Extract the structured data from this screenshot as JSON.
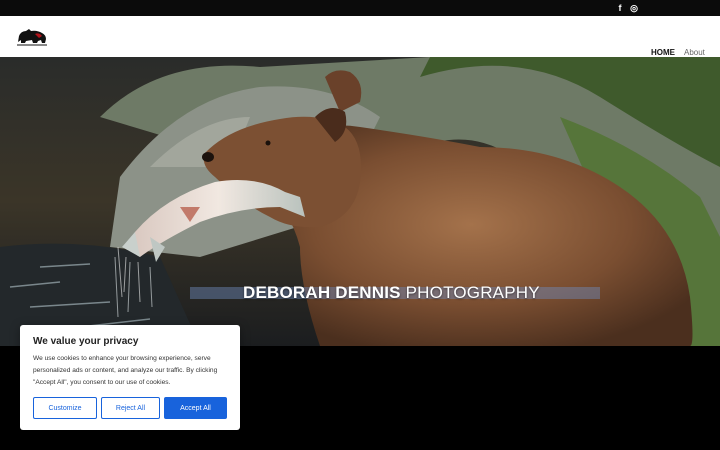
{
  "topbar": {
    "social": [
      {
        "name": "facebook",
        "glyph": "f"
      },
      {
        "name": "instagram",
        "glyph": "◎"
      }
    ]
  },
  "header": {
    "logo_icon": "bear-silhouette-logo",
    "nav": [
      {
        "label": "HOME",
        "active": true
      },
      {
        "label": "About",
        "active": false
      }
    ]
  },
  "hero": {
    "title_bold": "DEBORAH DENNIS",
    "title_rest": "PHOTOGRAPHY",
    "image": "grizzly bear holding salmon in river"
  },
  "cookie": {
    "title": "We value your privacy",
    "text": "We use cookies to enhance your browsing experience, serve personalized ads or content, and analyze our traffic. By clicking \"Accept All\", you consent to our use of cookies.",
    "buttons": {
      "customize": "Customize",
      "reject": "Reject All",
      "accept": "Accept All"
    }
  },
  "colors": {
    "accent": "#1863dc",
    "topbar": "#0b0b0b",
    "header": "#ffffff"
  }
}
